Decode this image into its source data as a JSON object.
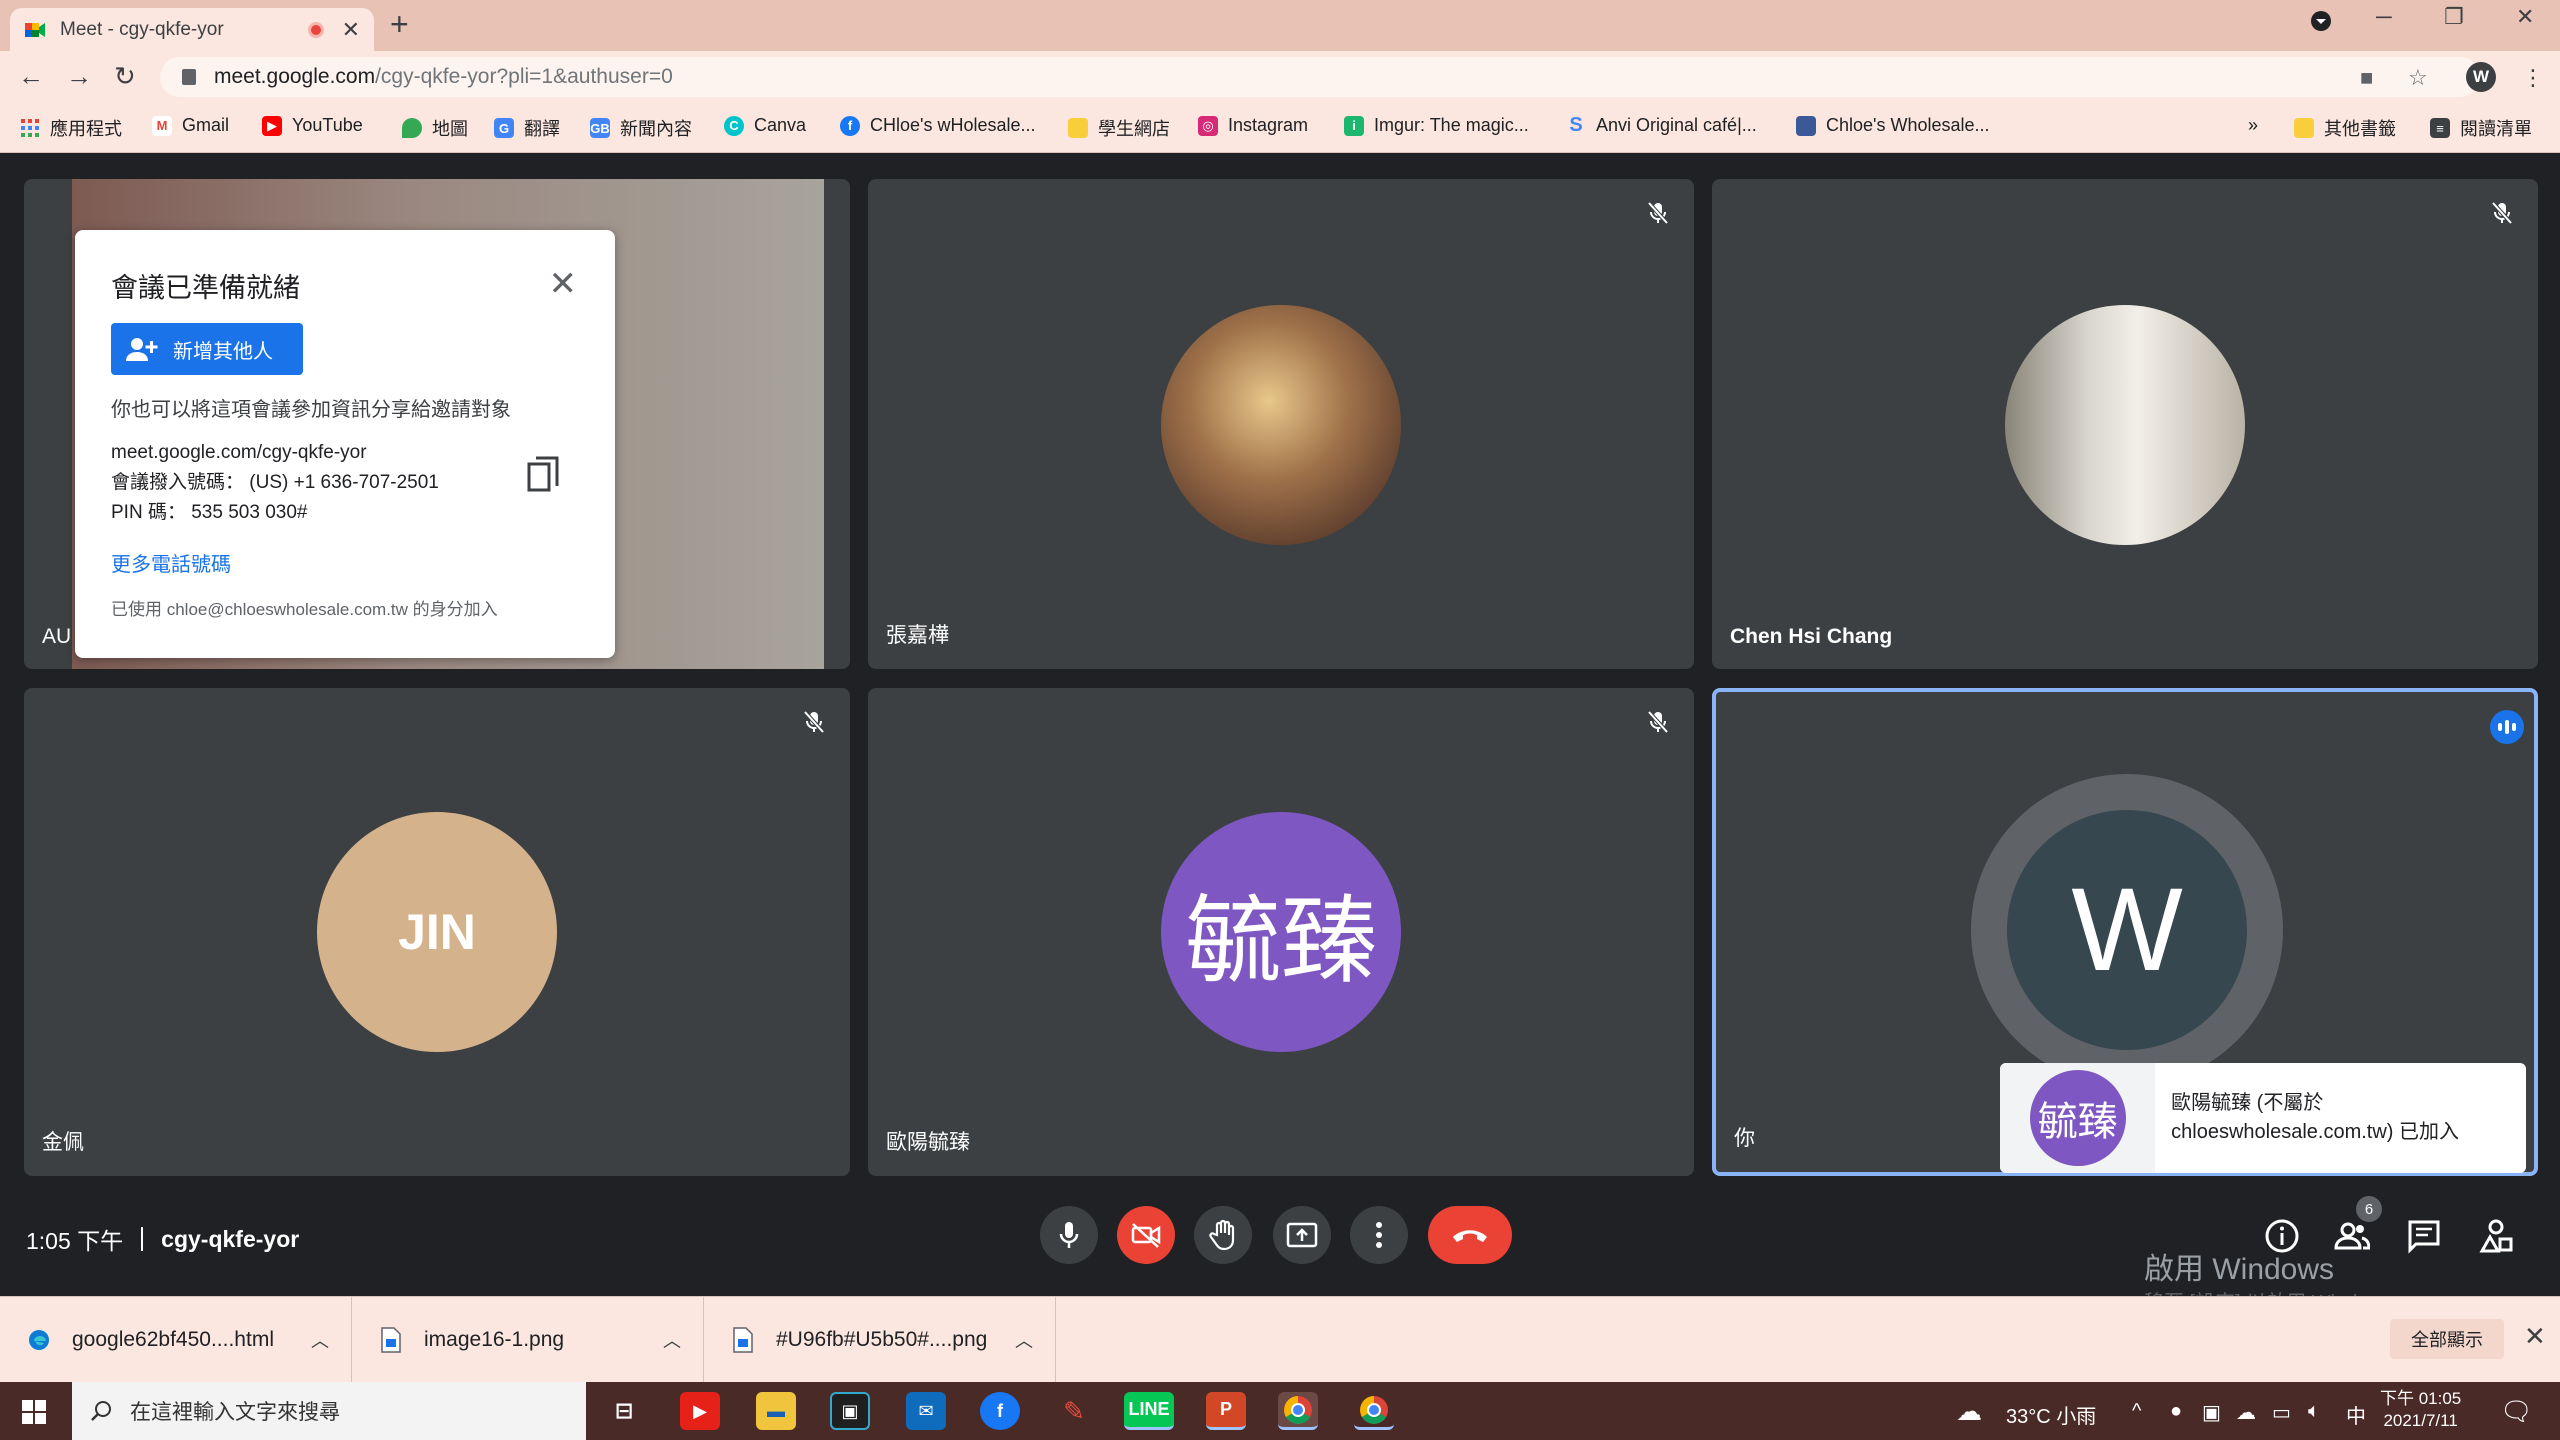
{
  "browser": {
    "tab_title": "Meet - cgy-qkfe-yor",
    "url_host": "meet.google.com",
    "url_path": "/cgy-qkfe-yor?pli=1&authuser=0",
    "profile_initial": "W"
  },
  "bookmarks": {
    "items": [
      {
        "label": "應用程式",
        "color": "#ea4335"
      },
      {
        "label": "Gmail",
        "color": "#ea4335"
      },
      {
        "label": "YouTube",
        "color": "#ff0000"
      },
      {
        "label": "地圖",
        "color": "#34a853"
      },
      {
        "label": "翻譯",
        "color": "#4285f4"
      },
      {
        "label": "新聞內容",
        "color": "#4285f4"
      },
      {
        "label": "Canva",
        "color": "#00c4cc"
      },
      {
        "label": "CHloe's wHolesale...",
        "color": "#1877f2"
      },
      {
        "label": "學生網店",
        "color": "#f9ce3b"
      },
      {
        "label": "Instagram",
        "color": "#d62976"
      },
      {
        "label": "Imgur: The magic...",
        "color": "#1bb76e"
      },
      {
        "label": "Anvi Original café|...",
        "color": "#4285f4"
      },
      {
        "label": "Chloe's Wholesale...",
        "color": "#3b5998"
      }
    ],
    "overflow": "»",
    "other": "其他書籤",
    "reading_list": "閱讀清單"
  },
  "tiles": [
    {
      "name": "AU",
      "initial": ""
    },
    {
      "name": "張嘉樺",
      "initial": ""
    },
    {
      "name": "Chen Hsi Chang",
      "initial": ""
    },
    {
      "name": "金佩",
      "initial": "JIN"
    },
    {
      "name": "歐陽毓臻",
      "initial": "毓臻"
    },
    {
      "name": "你",
      "initial": "W"
    }
  ],
  "info_card": {
    "title": "會議已準備就緒",
    "add_button": "新增其他人",
    "share_text": "你也可以將這項會議參加資訊分享給邀請對象",
    "link": "meet.google.com/cgy-qkfe-yor",
    "dial_in": "會議撥入號碼：  (US) +1 636-707-2501",
    "pin": "PIN 碼：  535 503 030#",
    "more_numbers": "更多電話號碼",
    "joined_as": "已使用 chloe@chloeswholesale.com.tw 的身分加入"
  },
  "toast": {
    "avatar_text": "毓臻",
    "message": "歐陽毓臻 (不屬於 chloeswholesale.com.tw) 已加入"
  },
  "meeting": {
    "time": "1:05 下午",
    "code": "cgy-qkfe-yor",
    "participant_count": "6"
  },
  "watermark": {
    "line1": "啟用 Windows",
    "line2": "移至 [設定] 以啟用 Windows。"
  },
  "downloads": {
    "items": [
      "google62bf450....html",
      "image16-1.png",
      "#U96fb#U5b50#....png"
    ],
    "show_all": "全部顯示"
  },
  "taskbar": {
    "search_placeholder": "在這裡輸入文字來搜尋",
    "weather": "33°C 小雨",
    "ime": "中",
    "time": "下午 01:05",
    "date": "2021/7/11"
  },
  "colors": {
    "accent": "#1a73e8",
    "end_call": "#ea4335",
    "tile_bg": "#3c4043",
    "page_bg": "#202124",
    "jin_avatar": "#d4b38c",
    "purple_avatar": "#7e57c2"
  }
}
